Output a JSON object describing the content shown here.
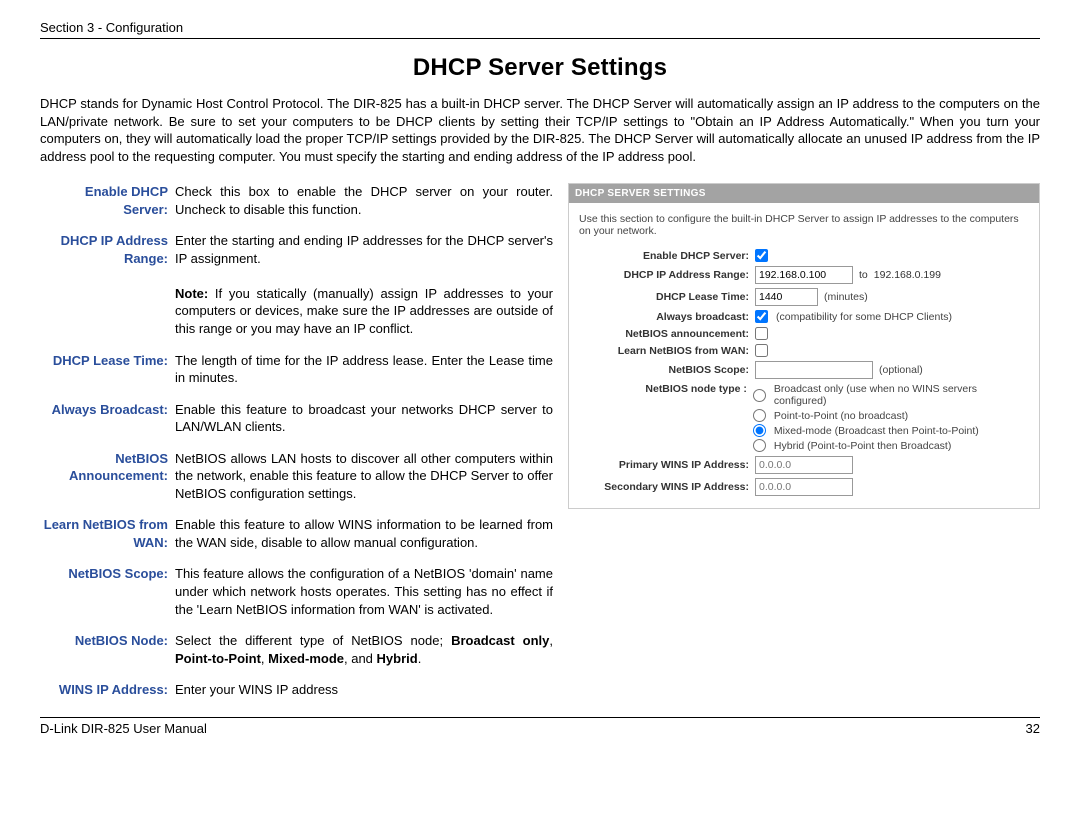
{
  "header": {
    "section": "Section 3 - Configuration"
  },
  "title": "DHCP Server Settings",
  "intro": "DHCP stands for Dynamic Host Control Protocol. The DIR-825 has a built-in DHCP server. The DHCP Server will automatically assign an IP address to the computers on the LAN/private network. Be sure to set your computers to be DHCP clients by setting their TCP/IP settings to \"Obtain an IP Address Automatically.\" When you turn your computers on, they will automatically load the proper TCP/IP settings provided by the DIR-825. The DHCP Server will automatically allocate an unused IP address from the IP address pool to the requesting computer. You must specify the starting and ending address of the IP address pool.",
  "defs": [
    {
      "label": "Enable DHCP Server:",
      "desc": "Check this box to enable the DHCP server on your router. Uncheck to disable this function."
    },
    {
      "label": "DHCP IP Address Range:",
      "desc": "Enter the starting and ending IP addresses for the DHCP server's IP assignment.",
      "note": "If you statically (manually) assign IP addresses to your computers or devices, make sure the IP addresses are outside of this range or you may have an IP conflict."
    },
    {
      "label": "DHCP Lease Time:",
      "desc": "The length of time for the IP address lease. Enter the Lease time in minutes."
    },
    {
      "label": "Always Broadcast:",
      "desc": "Enable this feature to broadcast your networks DHCP server to LAN/WLAN clients."
    },
    {
      "label": "NetBIOS Announcement:",
      "desc": "NetBIOS allows LAN hosts to discover all other computers within the network, enable this feature to allow the DHCP Server to offer NetBIOS configuration settings."
    },
    {
      "label": "Learn NetBIOS from WAN:",
      "desc": "Enable this feature to allow WINS information to be learned from the WAN side, disable to allow manual configuration."
    },
    {
      "label": "NetBIOS Scope:",
      "desc": "This feature allows the configuration of a NetBIOS 'domain' name under which network hosts operates. This setting has no effect if the 'Learn NetBIOS information from WAN' is activated."
    },
    {
      "label": "NetBIOS Node:",
      "desc_html": "Select the different type of NetBIOS node; <b>Broadcast only</b>, <b>Point-to-Point</b>, <b>Mixed-mode</b>, and <b>Hybrid</b>."
    },
    {
      "label": "WINS IP Address:",
      "desc": "Enter your WINS IP address"
    }
  ],
  "panel": {
    "title": "DHCP SERVER SETTINGS",
    "desc": "Use this section to configure the built-in DHCP Server to assign IP addresses to the computers on your network.",
    "rows": {
      "enable": {
        "label": "Enable DHCP Server:",
        "checked": true
      },
      "range": {
        "label": "DHCP IP Address Range:",
        "from": "192.168.0.100",
        "to_label": "to",
        "to_static": "192.168.0.199"
      },
      "lease": {
        "label": "DHCP Lease Time:",
        "value": "1440",
        "unit": "(minutes)"
      },
      "broadcast": {
        "label": "Always broadcast:",
        "checked": true,
        "hint": "(compatibility for some DHCP Clients)"
      },
      "announce": {
        "label": "NetBIOS announcement:",
        "checked": false
      },
      "learn": {
        "label": "Learn NetBIOS from WAN:",
        "checked": false
      },
      "scope": {
        "label": "NetBIOS Scope:",
        "value": "",
        "hint": "(optional)"
      },
      "nodetype": {
        "label": "NetBIOS node type :",
        "options": [
          {
            "text": "Broadcast only (use when no WINS servers configured)",
            "checked": false
          },
          {
            "text": "Point-to-Point (no broadcast)",
            "checked": false
          },
          {
            "text": "Mixed-mode (Broadcast then Point-to-Point)",
            "checked": true
          },
          {
            "text": "Hybrid (Point-to-Point then Broadcast)",
            "checked": false
          }
        ]
      },
      "primary": {
        "label": "Primary WINS IP Address:",
        "placeholder": "0.0.0.0"
      },
      "secondary": {
        "label": "Secondary WINS IP Address:",
        "placeholder": "0.0.0.0"
      }
    }
  },
  "footer": {
    "manual": "D-Link DIR-825 User Manual",
    "page": "32"
  },
  "misc": {
    "note_prefix": "Note:"
  }
}
